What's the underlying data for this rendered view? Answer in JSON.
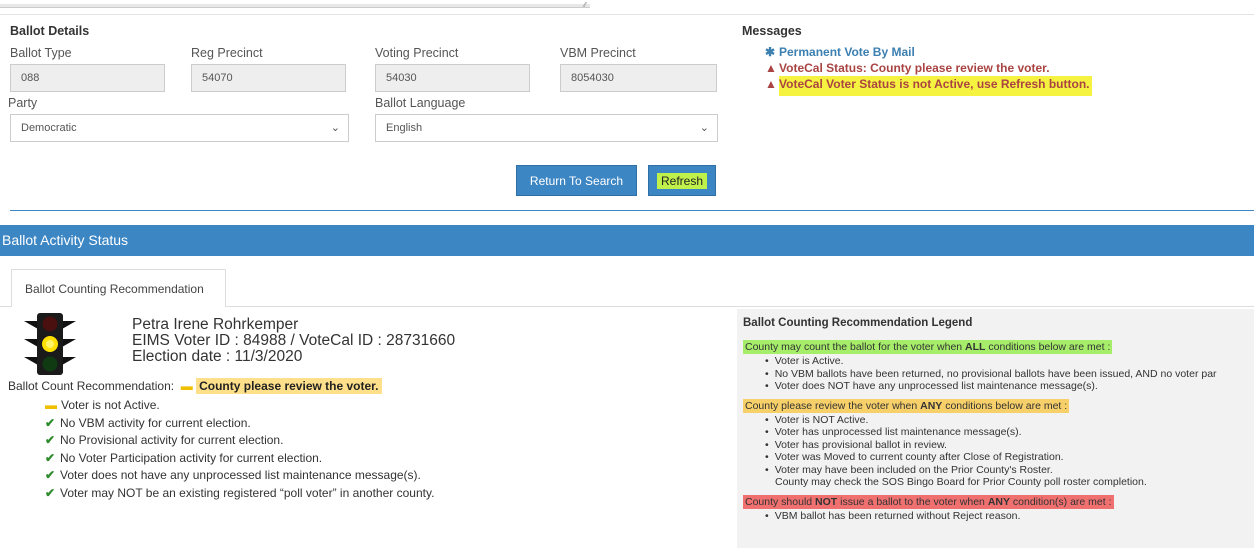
{
  "ballot_details": {
    "title": "Ballot Details",
    "ballot_type_label": "Ballot Type",
    "ballot_type_value": "088",
    "reg_precinct_label": "Reg Precinct",
    "reg_precinct_value": "54070",
    "voting_precinct_label": "Voting Precinct",
    "voting_precinct_value": "54030",
    "vbm_precinct_label": "VBM Precinct",
    "vbm_precinct_value": "8054030",
    "party_label": "Party",
    "party_value": "Democratic",
    "language_label": "Ballot Language",
    "language_value": "English"
  },
  "messages": {
    "title": "Messages",
    "items": [
      {
        "icon": "asterisk-icon",
        "glyph": "✱",
        "text": "Permanent Vote By Mail",
        "color": "#3c7fb1"
      },
      {
        "icon": "warning-icon",
        "glyph": "▲",
        "text": "VoteCal Status: County please review the voter.",
        "color": "#a94442"
      },
      {
        "icon": "warning-icon",
        "glyph": "▲",
        "text": "VoteCal Voter Status is not Active, use Refresh button.",
        "color": "#a94442"
      }
    ]
  },
  "buttons": {
    "return_label": "Return To Search",
    "refresh_label": "Refresh"
  },
  "activity": {
    "banner": "Ballot Activity Status",
    "tab_label": "Ballot Counting Recommendation"
  },
  "voter": {
    "name": "Petra Irene Rohrkemper",
    "ids": "EIMS Voter ID : 84988 / VoteCal ID : 28731660",
    "election": "Election date : 11/3/2020",
    "rec_label": "Ballot Count Recommendation:",
    "rec_value": "County please review the voter.",
    "warning": "Voter is not Active.",
    "checks": [
      "No VBM activity for current election.",
      "No Provisional activity for current election.",
      "No Voter Participation activity for current election.",
      "Voter does not have any unprocessed list maintenance message(s).",
      "Voter may NOT be an existing registered “poll voter” in another county."
    ]
  },
  "legend": {
    "title": "Ballot Counting Recommendation Legend",
    "green_header_pre": "County may count the ballot for the voter when ",
    "green_header_bold": "ALL",
    "green_header_post": " conditions below are met :",
    "green_items": [
      "Voter is Active.",
      "No VBM ballots have been returned, no provisional ballots have been issued, AND no voter par",
      "Voter does NOT have any unprocessed list maintenance message(s)."
    ],
    "yellow_header_pre": "County please review the voter when ",
    "yellow_header_bold": "ANY",
    "yellow_header_post": " conditions below are met :",
    "yellow_items": [
      "Voter is NOT Active.",
      "Voter has unprocessed list maintenance message(s).",
      "Voter has provisional ballot in review.",
      "Voter was Moved to current county after Close of Registration.",
      "Voter may have been included on the Prior County's Roster.",
      "County may check the SOS Bingo Board for Prior County poll roster completion."
    ],
    "red_header_pre": "County should ",
    "red_header_bold": "NOT",
    "red_header_mid": " issue a ballot to the voter when ",
    "red_header_bold2": "ANY",
    "red_header_post": " condition(s) are met :",
    "red_items": [
      "VBM ballot has been returned without Reject reason."
    ]
  }
}
